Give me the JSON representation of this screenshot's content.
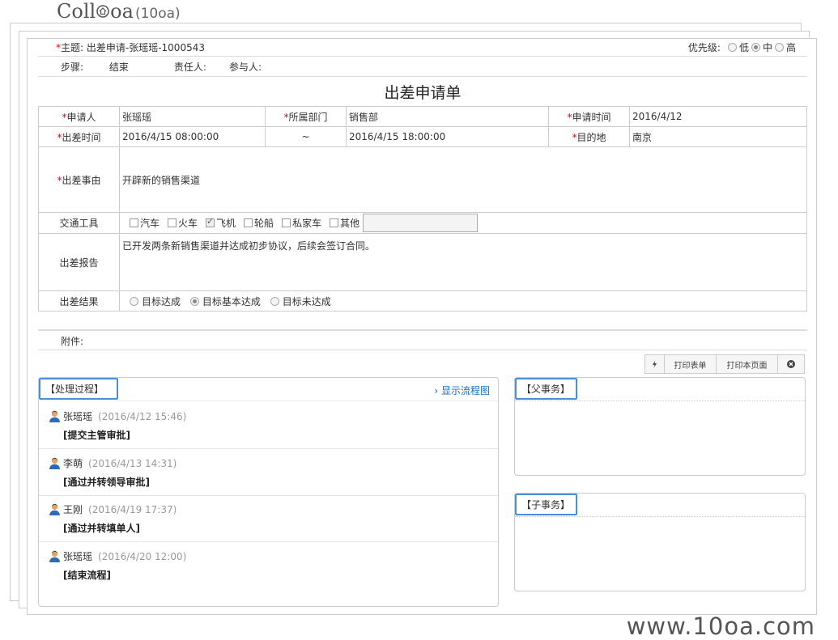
{
  "logo": {
    "brand": "Coll",
    "brand_mid": "oa",
    "brand_sub": "(10oa)"
  },
  "watermark": "www.10oa.com",
  "header": {
    "subject_label": "主题:",
    "subject_value": "出差申请-张瑶瑶-1000543",
    "priority_label": "优先级:",
    "priority_options": [
      "低",
      "中",
      "高"
    ],
    "priority_selected": "中",
    "step_label": "步骤:",
    "step_value": "结束",
    "owner_label": "责任人:",
    "participant_label": "参与人:"
  },
  "form": {
    "title": "出差申请单",
    "applicant_label": "申请人",
    "applicant_value": "张瑶瑶",
    "dept_label": "所属部门",
    "dept_value": "销售部",
    "apply_time_label": "申请时间",
    "apply_time_value": "2016/4/12",
    "trip_time_label": "出差时间",
    "trip_start": "2016/4/15 08:00:00",
    "trip_sep": "~",
    "trip_end": "2016/4/15 18:00:00",
    "dest_label": "目的地",
    "dest_value": "南京",
    "reason_label": "出差事由",
    "reason_value": "开辟新的销售渠道",
    "transport_label": "交通工具",
    "transport_options": [
      {
        "label": "汽车",
        "checked": false
      },
      {
        "label": "火车",
        "checked": false
      },
      {
        "label": "飞机",
        "checked": true
      },
      {
        "label": "轮船",
        "checked": false
      },
      {
        "label": "私家车",
        "checked": false
      },
      {
        "label": "其他",
        "checked": false
      }
    ],
    "report_label": "出差报告",
    "report_value": "已开发两条新销售渠道并达成初步协议，后续会签订合同。",
    "result_label": "出差结果",
    "result_options": [
      "目标达成",
      "目标基本达成",
      "目标未达成"
    ],
    "result_selected": "目标基本达成"
  },
  "attachment_label": "附件:",
  "toolbar": {
    "print_form": "打印表单",
    "print_page": "打印本页面"
  },
  "process": {
    "tab_label": "【处理过程】",
    "flow_link": "› 显示流程图",
    "entries": [
      {
        "name": "张瑶瑶",
        "time": "(2016/4/12 15:46)",
        "action": "[提交主管审批]"
      },
      {
        "name": "李萌",
        "time": "(2016/4/13 14:31)",
        "action": "[通过并转领导审批]"
      },
      {
        "name": "王刚",
        "time": "(2016/4/19 17:37)",
        "action": "[通过并转填单人]"
      },
      {
        "name": "张瑶瑶",
        "time": "(2016/4/20 12:00)",
        "action": "[结束流程]"
      }
    ]
  },
  "parent_task": {
    "tab_label": "【父事务】"
  },
  "child_task": {
    "tab_label": "【子事务】"
  },
  "colors": {
    "tab_border": "#4a90d9",
    "link": "#1a6fbf",
    "required": "#ee0000"
  }
}
